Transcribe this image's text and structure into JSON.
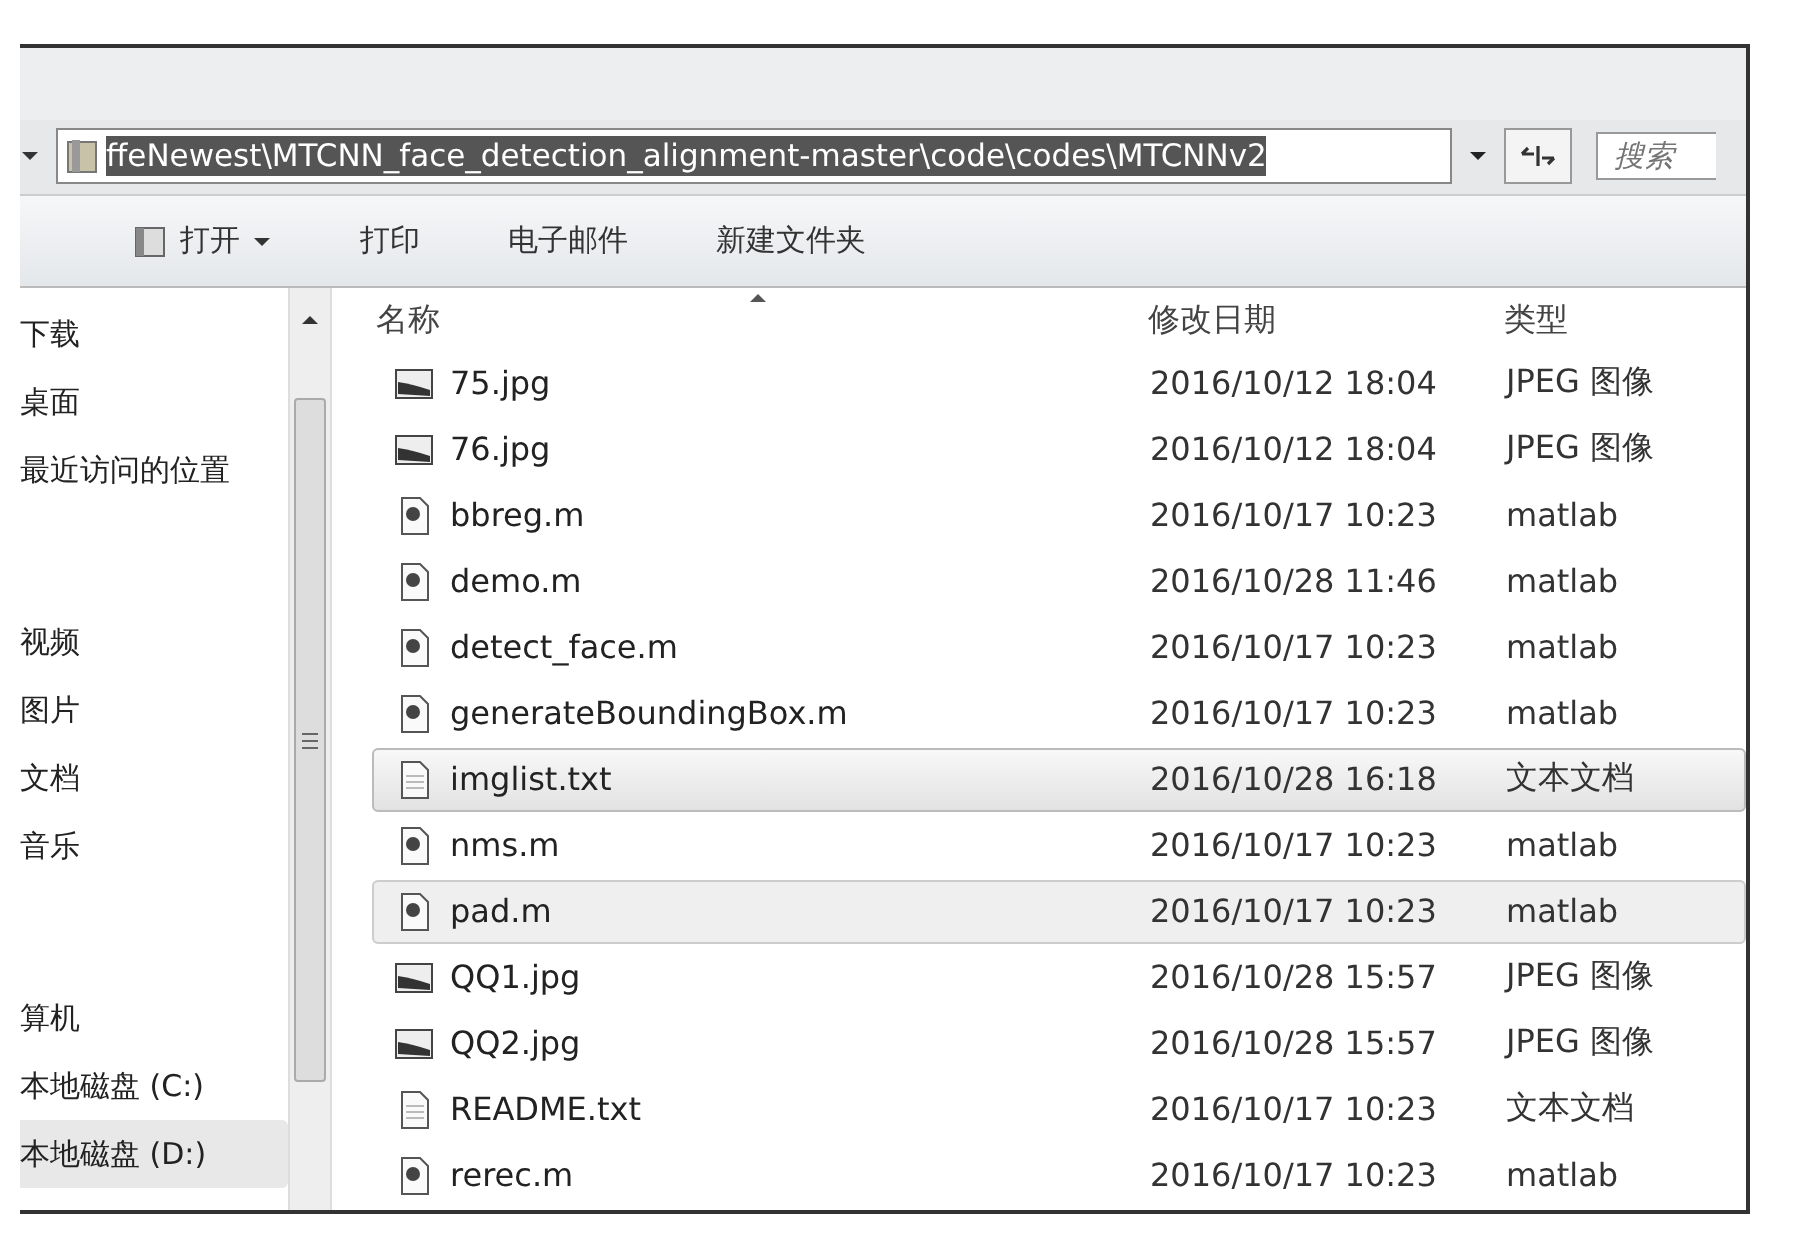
{
  "address_bar": {
    "path": "ffeNewest\\MTCNN_face_detection_alignment-master\\code\\codes\\MTCNNv2"
  },
  "search": {
    "placeholder": "搜索"
  },
  "toolbar": [
    {
      "label": "打开",
      "kind": "menu"
    },
    {
      "label": "打印",
      "kind": "plain"
    },
    {
      "label": "电子邮件",
      "kind": "plain"
    },
    {
      "label": "新建文件夹",
      "kind": "plain"
    }
  ],
  "sidebar": {
    "groups": [
      {
        "items": [
          {
            "label": "下载",
            "selected": false
          },
          {
            "label": "桌面",
            "selected": false
          },
          {
            "label": "最近访问的位置",
            "selected": false
          }
        ]
      },
      {
        "items": [
          {
            "label": "视频",
            "selected": false
          },
          {
            "label": "图片",
            "selected": false
          },
          {
            "label": "文档",
            "selected": false
          },
          {
            "label": "音乐",
            "selected": false
          }
        ]
      },
      {
        "items": [
          {
            "label": "算机",
            "selected": false
          },
          {
            "label": "本地磁盘 (C:)",
            "selected": false
          },
          {
            "label": "本地磁盘 (D:)",
            "selected": true
          }
        ]
      }
    ]
  },
  "table": {
    "columns": [
      "名称",
      "修改日期",
      "类型"
    ],
    "rows": [
      {
        "name": "75.jpg",
        "kind": "image",
        "date": "2016/10/12 18:04",
        "type": "JPEG 图像",
        "hovered": false,
        "selected": false
      },
      {
        "name": "76.jpg",
        "kind": "image",
        "date": "2016/10/12 18:04",
        "type": "JPEG 图像",
        "hovered": false,
        "selected": false
      },
      {
        "name": "bbreg.m",
        "kind": "matlab",
        "date": "2016/10/17 10:23",
        "type": "matlab",
        "hovered": false,
        "selected": false
      },
      {
        "name": "demo.m",
        "kind": "matlab",
        "date": "2016/10/28 11:46",
        "type": "matlab",
        "hovered": false,
        "selected": false
      },
      {
        "name": "detect_face.m",
        "kind": "matlab",
        "date": "2016/10/17 10:23",
        "type": "matlab",
        "hovered": false,
        "selected": false
      },
      {
        "name": "generateBoundingBox.m",
        "kind": "matlab",
        "date": "2016/10/17 10:23",
        "type": "matlab",
        "hovered": false,
        "selected": false
      },
      {
        "name": "imglist.txt",
        "kind": "text",
        "date": "2016/10/28 16:18",
        "type": "文本文档",
        "hovered": true,
        "selected": false
      },
      {
        "name": "nms.m",
        "kind": "matlab",
        "date": "2016/10/17 10:23",
        "type": "matlab",
        "hovered": false,
        "selected": false
      },
      {
        "name": "pad.m",
        "kind": "matlab",
        "date": "2016/10/17 10:23",
        "type": "matlab",
        "hovered": false,
        "selected": true
      },
      {
        "name": "QQ1.jpg",
        "kind": "image",
        "date": "2016/10/28 15:57",
        "type": "JPEG 图像",
        "hovered": false,
        "selected": false
      },
      {
        "name": "QQ2.jpg",
        "kind": "image",
        "date": "2016/10/28 15:57",
        "type": "JPEG 图像",
        "hovered": false,
        "selected": false
      },
      {
        "name": "README.txt",
        "kind": "text",
        "date": "2016/10/17 10:23",
        "type": "文本文档",
        "hovered": false,
        "selected": false
      },
      {
        "name": "rerec.m",
        "kind": "matlab",
        "date": "2016/10/17 10:23",
        "type": "matlab",
        "hovered": false,
        "selected": false
      }
    ]
  }
}
